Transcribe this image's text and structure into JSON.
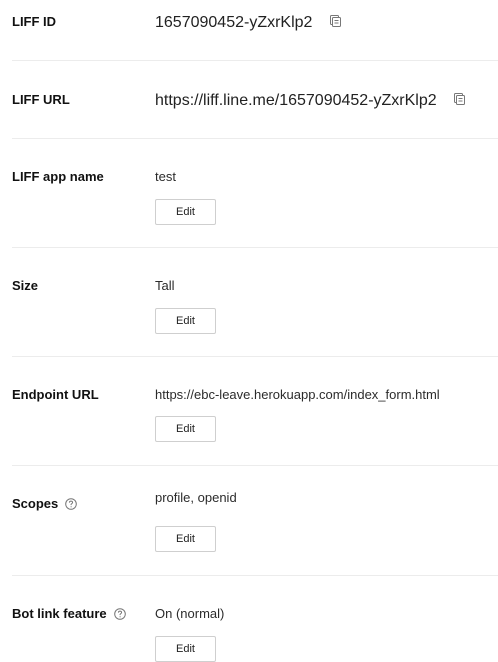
{
  "fields": {
    "liff_id": {
      "label": "LIFF ID",
      "value": "1657090452-yZxrKlp2",
      "copy_icon": "copy-icon"
    },
    "liff_url": {
      "label": "LIFF URL",
      "value": "https://liff.line.me/1657090452-yZxrKlp2",
      "copy_icon": "copy-icon"
    },
    "app_name": {
      "label": "LIFF app name",
      "value": "test",
      "edit_label": "Edit"
    },
    "size": {
      "label": "Size",
      "value": "Tall",
      "edit_label": "Edit"
    },
    "endpoint_url": {
      "label": "Endpoint URL",
      "value": "https://ebc-leave.herokuapp.com/index_form.html",
      "edit_label": "Edit"
    },
    "scopes": {
      "label": "Scopes",
      "help_icon": "help-circle-icon",
      "value": "profile, openid",
      "edit_label": "Edit"
    },
    "bot_link": {
      "label": "Bot link feature",
      "help_icon": "help-circle-icon",
      "value": "On (normal)",
      "edit_label": "Edit"
    }
  },
  "colors": {
    "text": "#222222",
    "label": "#111111",
    "divider": "#ececec",
    "button_border": "#cfcfcf",
    "icon": "#777777"
  }
}
